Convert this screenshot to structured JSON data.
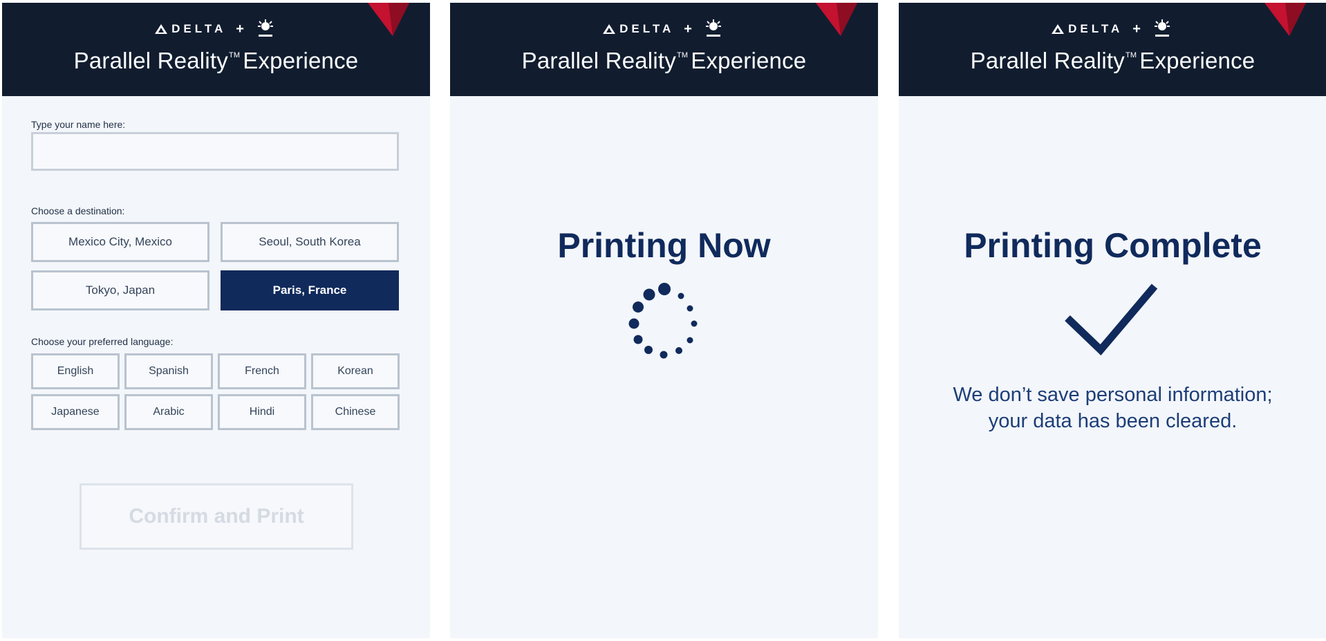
{
  "header": {
    "delta_wordmark": "DELTA",
    "plus_sign": "+",
    "title_main": "Parallel Reality",
    "title_trademark": "TM",
    "title_suffix": "Experience",
    "delta_mark_icon": "delta-triangle-icon",
    "partner_logo_icon": "misapplied-sciences-logo-icon",
    "corner_logo_icon": "delta-widget-logo-icon",
    "colors": {
      "header_bg": "#111d2f",
      "delta_red": "#c41230"
    }
  },
  "form_screen": {
    "name_label": "Type your name here:",
    "name_value": "",
    "destination_label": "Choose a destination:",
    "destinations": [
      "Mexico City, Mexico",
      "Seoul, South Korea",
      "Tokyo, Japan",
      "Paris, France"
    ],
    "selected_destination": "Paris, France",
    "language_label": "Choose your preferred language:",
    "languages": [
      "English",
      "Spanish",
      "French",
      "Korean",
      "Japanese",
      "Arabic",
      "Hindi",
      "Chinese"
    ],
    "confirm_label": "Confirm and Print"
  },
  "printing_screen": {
    "status_text": "Printing Now",
    "spinner_icon": "loading-spinner-icon"
  },
  "complete_screen": {
    "status_text": "Printing Complete",
    "check_icon": "checkmark-icon",
    "message_line1": "We don’t save personal information;",
    "message_line2": "your data has been cleared."
  },
  "colors": {
    "accent_navy": "#102a5c",
    "screen_bg": "#f3f6fa",
    "text_blue": "#1d3e78"
  }
}
